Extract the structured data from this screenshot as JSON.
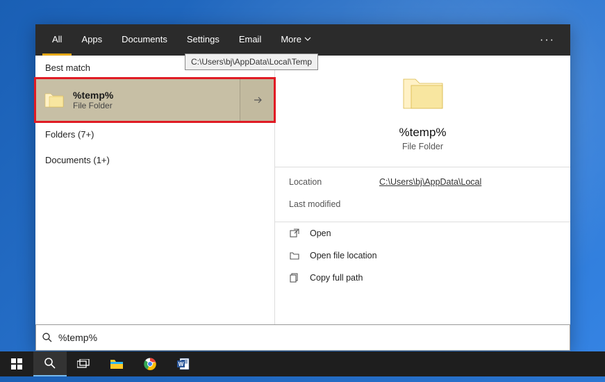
{
  "tabs": {
    "all": "All",
    "apps": "Apps",
    "documents": "Documents",
    "settings": "Settings",
    "email": "Email",
    "more": "More"
  },
  "tooltip": "C:\\Users\\bj\\AppData\\Local\\Temp",
  "left": {
    "best_match": "Best match",
    "result": {
      "title": "%temp%",
      "subtitle": "File Folder"
    },
    "folders": "Folders (7+)",
    "documents": "Documents (1+)"
  },
  "preview": {
    "title": "%temp%",
    "subtitle": "File Folder",
    "location_label": "Location",
    "location_value": "C:\\Users\\bj\\AppData\\Local",
    "modified_label": "Last modified"
  },
  "actions": {
    "open": "Open",
    "open_location": "Open file location",
    "copy_path": "Copy full path"
  },
  "search": {
    "query": "%temp%"
  }
}
